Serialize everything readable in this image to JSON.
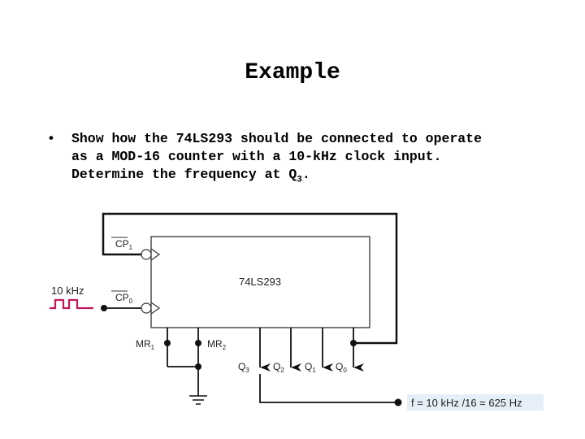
{
  "slide": {
    "title": "Example",
    "bullet_symbol": "•",
    "bullet_lines": [
      "Show how the 74LS293 should be connected to operate",
      "as a MOD-16 counter with a 10-kHz clock input.",
      "Determine the frequency at Q"
    ],
    "bullet_subscript": "3",
    "bullet_end": "."
  },
  "diagram": {
    "chip_label": "74LS293",
    "clock_label": "10 kHz",
    "clock_color": "#c2185b",
    "pins": {
      "cp1": "CP",
      "cp1_sub": "1",
      "cp0": "CP",
      "cp0_sub": "0",
      "mr1": "MR",
      "mr1_sub": "1",
      "mr2": "MR",
      "mr2_sub": "2",
      "q3": "Q",
      "q3_sub": "3",
      "q2": "Q",
      "q2_sub": "2",
      "q1": "Q",
      "q1_sub": "1",
      "q0": "Q",
      "q0_sub": "0"
    },
    "result_label": "f = 10 kHz /16 = 625 Hz",
    "result_bg": "#e6eff8"
  }
}
